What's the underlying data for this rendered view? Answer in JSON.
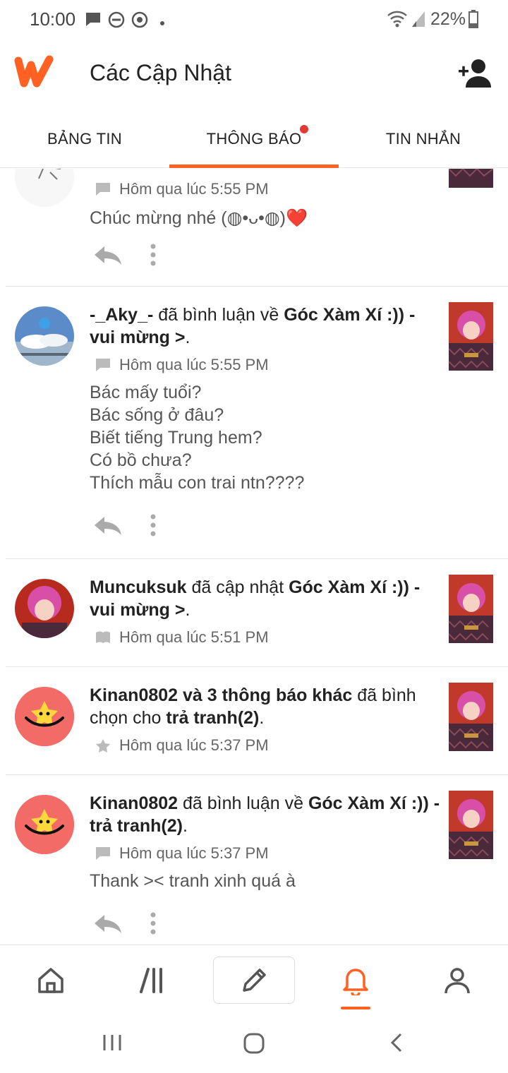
{
  "status_bar": {
    "time": "10:00",
    "battery_percent": "22%",
    "icons": [
      "message-icon",
      "do-not-disturb-icon",
      "vpn-icon",
      "dot-icon",
      "wifi-icon",
      "signal-icon",
      "battery-icon"
    ]
  },
  "app_bar": {
    "title": "Các Cập Nhật",
    "logo": "wattpad-logo",
    "action_icon": "add-user-icon"
  },
  "tabs": [
    {
      "label": "BẢNG TIN",
      "active": false,
      "has_dot": false
    },
    {
      "label": "THÔNG BÁO",
      "active": true,
      "has_dot": true
    },
    {
      "label": "TIN NHẮN",
      "active": false,
      "has_dot": false
    }
  ],
  "colors": {
    "accent": "#ff6122",
    "notification_dot": "#e53935",
    "star_avatar_bg": "#f26b66",
    "star_color": "#ffd83b"
  },
  "feed": [
    {
      "type": "comment",
      "timestamp": "Hôm qua lúc 5:55 PM",
      "meta_icon": "comment-icon",
      "comment": "Chúc mừng nhé (◍•ᴗ•◍)❤️"
    },
    {
      "type": "comment",
      "user": "-_Aky_-",
      "action": " đã bình luận về ",
      "target": "Góc Xàm Xí :)) - vui mừng >",
      "suffix": ".",
      "timestamp": "Hôm qua lúc 5:55 PM",
      "meta_icon": "comment-icon",
      "comment": "Bác mấy tuổi?\nBác sống ở đâu?\nBiết tiếng Trung hem?\nCó bồ chưa?\nThích mẫu con trai ntn????"
    },
    {
      "type": "update",
      "user": "Muncuksuk",
      "action": " đã cập nhật ",
      "target": "Góc Xàm Xí :)) - vui mừng >",
      "suffix": ".",
      "timestamp": "Hôm qua lúc 5:51 PM",
      "meta_icon": "book-icon"
    },
    {
      "type": "vote",
      "user": "Kinan0802 và 3 thông báo khác",
      "action": " đã bình chọn cho ",
      "target": "trả tranh(2)",
      "suffix": ".",
      "timestamp": "Hôm qua lúc 5:37 PM",
      "meta_icon": "star-icon"
    },
    {
      "type": "comment",
      "user": "Kinan0802",
      "action": " đã bình luận về ",
      "target": "Góc Xàm Xí :)) - trả tranh(2)",
      "suffix": ".",
      "timestamp": "Hôm qua lúc 5:37 PM",
      "meta_icon": "comment-icon",
      "comment": "Thank >< tranh xinh quá à"
    }
  ],
  "bottom_nav": [
    {
      "name": "home",
      "icon": "home-icon",
      "active": false
    },
    {
      "name": "library",
      "icon": "library-icon",
      "active": false
    },
    {
      "name": "write",
      "icon": "pencil-icon",
      "active": false
    },
    {
      "name": "notifications",
      "icon": "bell-icon",
      "active": true
    },
    {
      "name": "profile",
      "icon": "user-icon",
      "active": false
    }
  ],
  "system_nav": [
    "recents-icon",
    "home-circle-icon",
    "back-icon"
  ]
}
